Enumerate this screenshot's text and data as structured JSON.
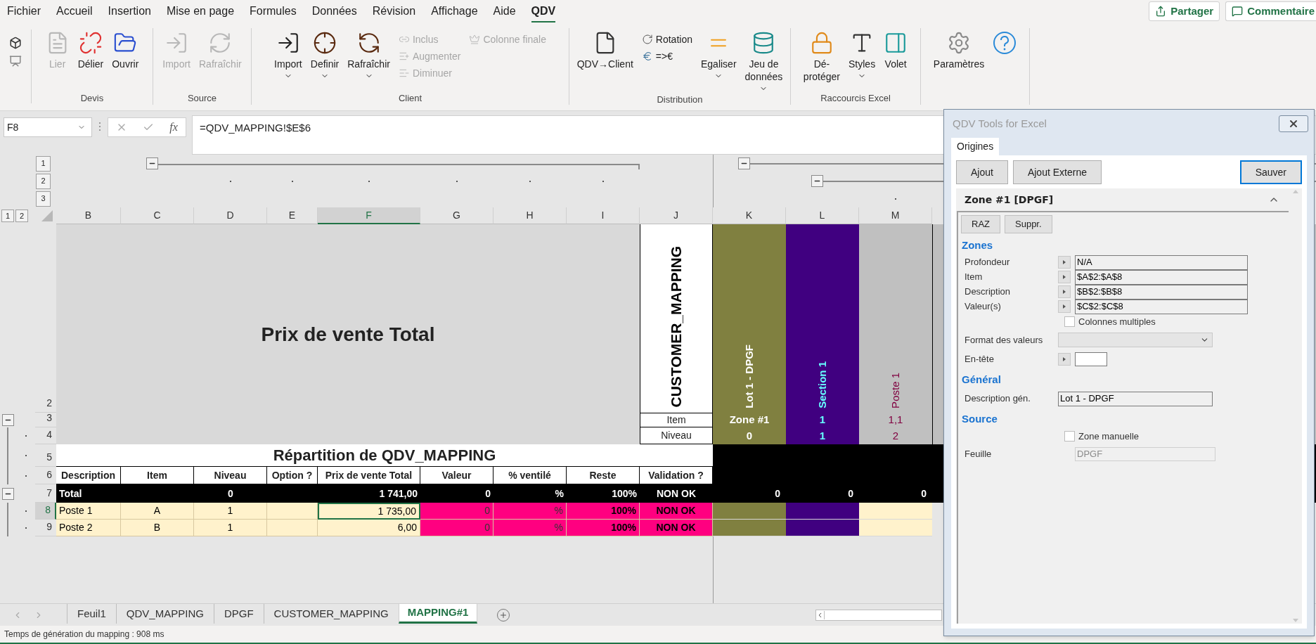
{
  "menu_tabs": [
    {
      "label": "Fichier",
      "selected": false
    },
    {
      "label": "Accueil",
      "selected": false
    },
    {
      "label": "Insertion",
      "selected": false
    },
    {
      "label": "Mise en page",
      "selected": false
    },
    {
      "label": "Formules",
      "selected": false
    },
    {
      "label": "Données",
      "selected": false
    },
    {
      "label": "Révision",
      "selected": false
    },
    {
      "label": "Affichage",
      "selected": false
    },
    {
      "label": "Aide",
      "selected": false
    },
    {
      "label": "QDV",
      "selected": true
    }
  ],
  "share_button": "Partager",
  "comments_button": "Commentaire",
  "ribbon": {
    "groups": [
      {
        "label": "Devis",
        "items": [
          {
            "kind": "large",
            "label": "Lier",
            "disabled": true,
            "dropdown": false
          },
          {
            "kind": "large",
            "label": "Délier",
            "disabled": false,
            "dropdown": false
          },
          {
            "kind": "large",
            "label": "Ouvrir",
            "disabled": false,
            "dropdown": false
          }
        ]
      },
      {
        "label": "Source",
        "items": [
          {
            "kind": "large",
            "label": "Import",
            "disabled": true,
            "dropdown": false
          },
          {
            "kind": "large",
            "label": "Rafraîchir",
            "disabled": true,
            "dropdown": false
          }
        ]
      },
      {
        "label": "Client",
        "items": [
          {
            "kind": "large",
            "label": "Import",
            "disabled": false,
            "dropdown": true
          },
          {
            "kind": "large",
            "label": "Definir",
            "disabled": false,
            "dropdown": true
          },
          {
            "kind": "large",
            "label": "Rafraîchir",
            "disabled": false,
            "dropdown": true
          },
          {
            "kind": "stack",
            "items": [
              {
                "label": "Inclus",
                "disabled": true
              },
              {
                "label": "Augmenter",
                "disabled": true
              },
              {
                "label": "Diminuer",
                "disabled": true
              }
            ]
          },
          {
            "kind": "stack",
            "items": [
              {
                "label": "Colonne finale",
                "disabled": true
              }
            ]
          }
        ]
      },
      {
        "label": "Distribution",
        "items": [
          {
            "kind": "large",
            "label": "QDV→Client",
            "disabled": false,
            "dropdown": false
          },
          {
            "kind": "stack",
            "items": [
              {
                "label": "Rotation",
                "disabled": false
              },
              {
                "label": "=>€",
                "disabled": false
              }
            ]
          },
          {
            "kind": "large",
            "label": "Egaliser",
            "disabled": false,
            "dropdown": true
          },
          {
            "kind": "large",
            "label": "Jeu de\ndonnées",
            "disabled": false,
            "dropdown": true
          }
        ]
      },
      {
        "label": "Raccourcis Excel",
        "items": [
          {
            "kind": "large",
            "label": "Dé-\nprotéger",
            "disabled": false,
            "dropdown": false
          },
          {
            "kind": "large",
            "label": "Styles",
            "disabled": false,
            "dropdown": true
          },
          {
            "kind": "large",
            "label": "Volet",
            "disabled": false,
            "dropdown": false
          }
        ]
      },
      {
        "items": [
          {
            "kind": "large",
            "label": "Paramètres",
            "disabled": false,
            "dropdown": false
          },
          {
            "kind": "large",
            "disabled": false,
            "dropdown": false
          }
        ]
      }
    ]
  },
  "formula_bar": {
    "name_box": "F8",
    "function_label": "fx",
    "formula": "=QDV_MAPPING!$E$6"
  },
  "outline_levels": {
    "rows": [
      "1",
      "2"
    ],
    "columns": [
      "1",
      "2",
      "3"
    ]
  },
  "columns": [
    {
      "label": "B",
      "selected": false
    },
    {
      "label": "C",
      "selected": false
    },
    {
      "label": "D",
      "selected": false
    },
    {
      "label": "E",
      "selected": false
    },
    {
      "label": "F",
      "selected": true
    },
    {
      "label": "G",
      "selected": false
    },
    {
      "label": "H",
      "selected": false
    },
    {
      "label": "I",
      "selected": false
    },
    {
      "label": "J",
      "selected": false
    },
    {
      "label": "K",
      "selected": false
    },
    {
      "label": "L",
      "selected": false
    },
    {
      "label": "M",
      "selected": false
    }
  ],
  "row_headers": [
    {
      "label": "2",
      "selected": false,
      "kind": "plain"
    },
    {
      "label": "3",
      "selected": false,
      "kind": "collapse"
    },
    {
      "label": "4",
      "selected": false,
      "kind": "grouped"
    },
    {
      "label": "5",
      "selected": false,
      "kind": "grouped"
    },
    {
      "label": "6",
      "selected": false,
      "kind": "grouped"
    },
    {
      "label": "7",
      "selected": false,
      "kind": "collapse"
    },
    {
      "label": "8",
      "selected": true,
      "kind": "grouped"
    },
    {
      "label": "9",
      "selected": false,
      "kind": "grouped"
    }
  ],
  "sheet": {
    "title": "Prix de vente Total",
    "mapping_title": "CUSTOMER_MAPPING",
    "item_label": "Item",
    "niveau_label": "Niveau",
    "mapping_columns": [
      {
        "header": "Lot 1 - DPGF",
        "item": "Zone #1",
        "niveau": "0",
        "total": "0",
        "color": "#808040",
        "text": {
          "color": "#ffffff"
        },
        "body": {
          "color": "#808040"
        },
        "bold": true
      },
      {
        "header": "Section 1",
        "item": "1",
        "niveau": "1",
        "total": "0",
        "color": "#400080",
        "text": {
          "color": "#66ffff"
        },
        "body": {
          "color": "#400080"
        },
        "bold": true
      },
      {
        "header": "Poste 1",
        "item": "1,1",
        "niveau": "2",
        "total": "0",
        "color": "#c0c0c0",
        "text": {
          "color": "#800040"
        },
        "body": {
          "color": "#fff2cc"
        },
        "bold": false
      }
    ],
    "split_title": "Répartition de QDV_MAPPING",
    "split_columns": [
      "Description",
      "Item",
      "Niveau",
      "Option ?",
      "Prix de vente Total",
      "Valeur",
      "% ventilé",
      "Reste",
      "Validation ?"
    ],
    "total_row": {
      "description": "Total",
      "niveau": "0",
      "price": "1 741,00",
      "valeur": "0",
      "ventile": "%",
      "reste": "100%",
      "validation": "NON OK"
    },
    "rows": [
      {
        "description": "Poste 1",
        "item": "A",
        "niveau": "1",
        "price": "1 735,00",
        "valeur": "0",
        "ventile": "%",
        "reste": "100%",
        "validation": "NON OK"
      },
      {
        "description": "Poste 2",
        "item": "B",
        "niveau": "1",
        "price": "6,00",
        "valeur": "0",
        "ventile": "%",
        "reste": "100%",
        "validation": "NON OK"
      }
    ]
  },
  "sheet_tabs": [
    {
      "label": "Feuil1",
      "selected": false
    },
    {
      "label": "QDV_MAPPING",
      "selected": false
    },
    {
      "label": "DPGF",
      "selected": false
    },
    {
      "label": "CUSTOMER_MAPPING",
      "selected": false
    },
    {
      "label": "MAPPING#1",
      "selected": true
    }
  ],
  "status_text": "Temps de génération du mapping : 908 ms",
  "dialog": {
    "title": "QDV Tools for Excel",
    "tabs": [
      {
        "label": "Origines",
        "selected": true
      }
    ],
    "buttons": [
      {
        "label": "Ajout",
        "default": false
      },
      {
        "label": "Ajout Externe",
        "default": false
      },
      {
        "label": "Sauver",
        "default": true
      }
    ],
    "zone": {
      "title": "Zone #1 [DPGF]",
      "expanded": true,
      "buttons": [
        "RAZ",
        "Suppr."
      ],
      "sections": [
        {
          "title": "Zones",
          "fields": [
            {
              "kind": "ref",
              "label": "Profondeur",
              "value": "N/A"
            },
            {
              "kind": "ref",
              "label": "Item",
              "value": "$A$2:$A$8"
            },
            {
              "kind": "ref",
              "label": "Description",
              "value": "$B$2:$B$8"
            },
            {
              "kind": "ref",
              "label": "Valeur(s)",
              "value": "$C$2:$C$8"
            },
            {
              "kind": "checkbox",
              "label": "Colonnes multiples",
              "checked": false
            },
            {
              "kind": "select",
              "label": "Format des valeurs"
            },
            {
              "kind": "short_ref",
              "label": "En-tête"
            }
          ]
        },
        {
          "title": "Général",
          "fields": [
            {
              "kind": "text",
              "label": "Description gén.",
              "value": "Lot 1 - DPGF",
              "disabled": false
            }
          ]
        },
        {
          "title": "Source",
          "fields": [
            {
              "kind": "checkbox",
              "label": "Zone manuelle",
              "checked": false
            },
            {
              "kind": "text",
              "label": "Feuille",
              "value": "DPGF",
              "disabled": true
            }
          ]
        }
      ]
    }
  }
}
